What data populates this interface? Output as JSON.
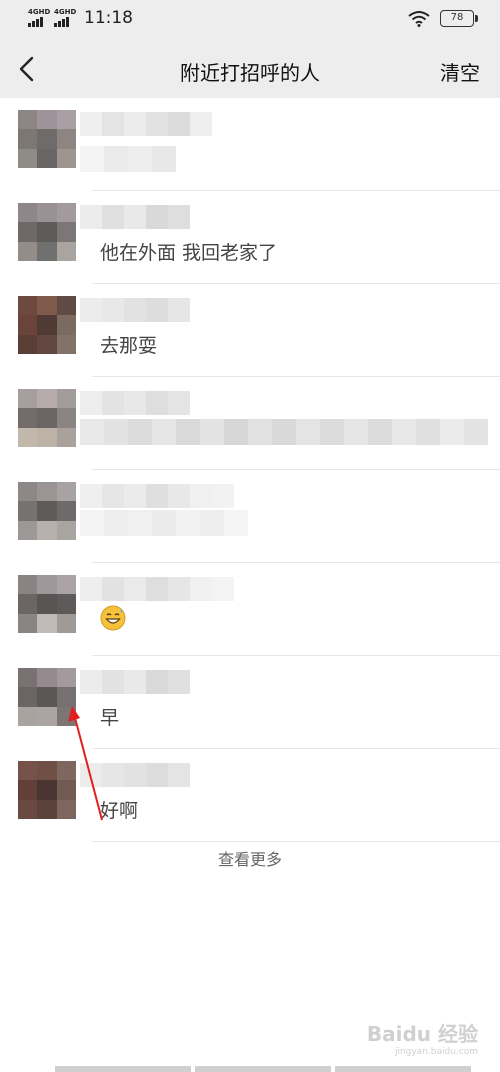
{
  "status_bar": {
    "signal_1": "4GHD",
    "signal_2": "4GHD",
    "time": "11:18",
    "battery": "78"
  },
  "nav": {
    "title": "附近打招呼的人",
    "clear_label": "清空"
  },
  "rows": [
    {
      "message": ""
    },
    {
      "message": "他在外面 我回老家了"
    },
    {
      "message": "去那耍"
    },
    {
      "message": ""
    },
    {
      "message": ""
    },
    {
      "message": ""
    },
    {
      "message": "早"
    },
    {
      "message": "好啊"
    }
  ],
  "more_label": "查看更多",
  "watermark": {
    "brand": "Baidu 经验",
    "url": "jingyan.baidu.com"
  },
  "colors": {
    "nav_bg": "#ededed",
    "annotation_arrow": "#e02020"
  }
}
